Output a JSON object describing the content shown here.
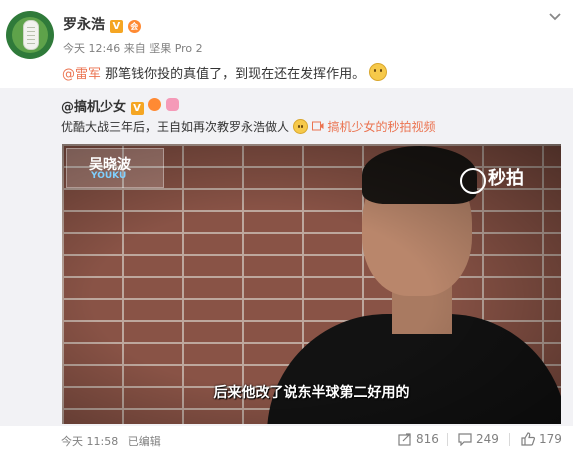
{
  "poster": {
    "name": "罗永浩",
    "verified_badge": "V",
    "level_badge": "会",
    "time": "今天 12:46",
    "source_prefix": "来自",
    "source": "坚果 Pro 2"
  },
  "post": {
    "mention": "@雷军",
    "text": " 那笔钱你投的真值了，到现在还在发挥作用。"
  },
  "repost": {
    "author": "@搞机少女",
    "text": "优酷大战三年后，王自如再次教罗永浩做人",
    "link_label": "搞机少女的秒拍视频"
  },
  "video": {
    "show_logo_title": "吴晓波",
    "show_logo_sub": "YOUKU",
    "watermark": "秒拍",
    "subtitle": "后来他改了说东半球第二好用的"
  },
  "footer": {
    "time": "今天 11:58",
    "edited": "已编辑",
    "shares": "816",
    "comments": "249",
    "likes": "179"
  },
  "colors": {
    "accent": "#eb7350",
    "verified": "#f5a623",
    "repost_bg": "#f2f2f5"
  }
}
